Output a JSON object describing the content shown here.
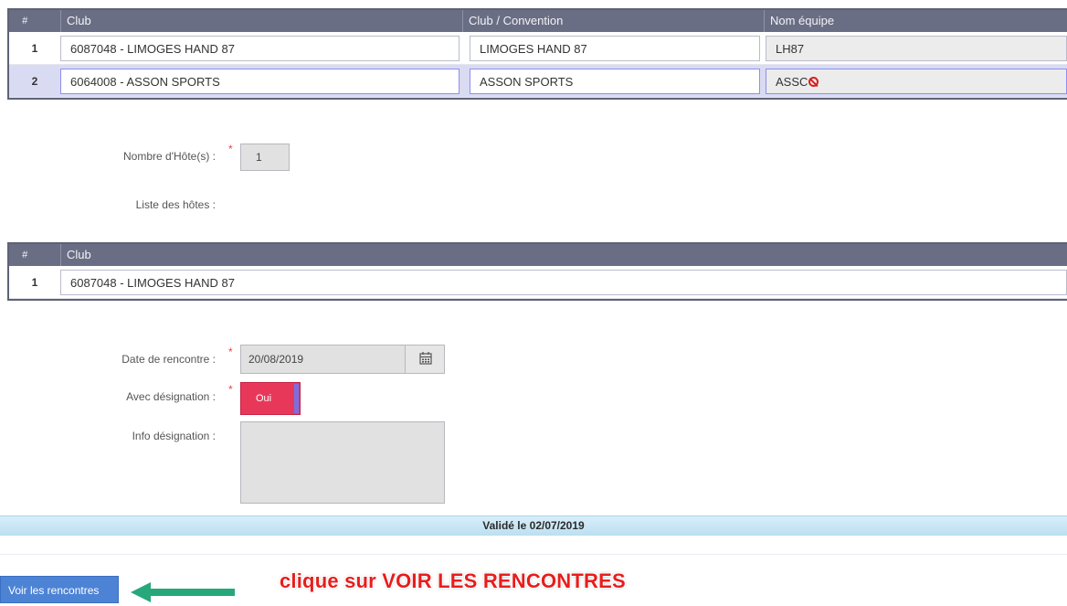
{
  "teams_table": {
    "headers": {
      "num": "#",
      "club": "Club",
      "convention": "Club / Convention",
      "team_name": "Nom équipe"
    },
    "rows": [
      {
        "num": "1",
        "club": "6087048 - LIMOGES HAND 87",
        "convention": "LIMOGES HAND 87",
        "team_name": "LH87",
        "selected": false
      },
      {
        "num": "2",
        "club": "6064008 - ASSON SPORTS",
        "convention": "ASSON SPORTS",
        "team_name": "ASSC",
        "selected": true
      }
    ]
  },
  "hosts": {
    "count_label": "Nombre d'Hôte(s) :",
    "count_value": "1",
    "list_label": "Liste des hôtes :",
    "required_mark": "*"
  },
  "hosts_table": {
    "headers": {
      "num": "#",
      "club": "Club"
    },
    "rows": [
      {
        "num": "1",
        "club": "6087048 - LIMOGES HAND 87"
      }
    ]
  },
  "match": {
    "date_label": "Date de rencontre :",
    "date_value": "20/08/2019",
    "calendar_icon": "calendar-icon",
    "designation_label": "Avec désignation :",
    "designation_value": "Oui",
    "info_label": "Info désignation :",
    "info_value": ""
  },
  "status": {
    "validated_text": "Validé le 02/07/2019"
  },
  "footer": {
    "button_label": "Voir les rencontres",
    "annotation": "clique sur VOIR LES RENCONTRES"
  },
  "colors": {
    "toggle_on": "#e8385a",
    "button": "#4d83d5",
    "annotation": "#e81d1d",
    "arrow": "#26a87a"
  }
}
